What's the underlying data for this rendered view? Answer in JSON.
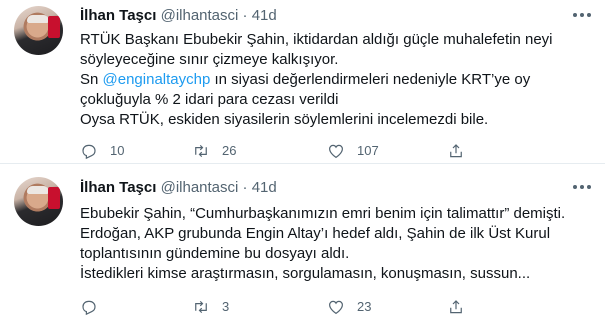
{
  "tweets": [
    {
      "author_name": "İlhan Taşcı",
      "handle": "@ilhantasci",
      "separator": "·",
      "time": "41d",
      "lines": [
        "RTÜK Başkanı Ebubekir Şahin, iktidardan aldığı güçle muhalefetin neyi",
        "söyleyeceğine sınır çizmeye kalkışıyor."
      ],
      "line3_prefix": "Sn ",
      "mention": "@enginaltaychp",
      "line3_suffix": " ın siyasi değerlendirmeleri nedeniyle KRT’ye oy",
      "line4": "çokluğuyla % 2 idari para cezası verildi",
      "line5": "Oysa RTÜK, eskiden siyasilerin söylemlerini incelemezdi bile.",
      "replies": "10",
      "retweets": "26",
      "likes": "107"
    },
    {
      "author_name": "İlhan Taşcı",
      "handle": "@ilhantasci",
      "separator": "·",
      "time": "41d",
      "lines": [
        "Ebubekir Şahin, “Cumhurbaşkanımızın emri benim için talimattır” demişti.",
        "Erdoğan, AKP grubunda Engin Altay’ı hedef aldı, Şahin de ilk Üst Kurul",
        "toplantısının gündemine bu dosyayı aldı.",
        "İstedikleri kimse araştırmasın, sorgulamasın, konuşmasın, sussun..."
      ],
      "replies": "",
      "retweets": "3",
      "likes": "23"
    }
  ]
}
